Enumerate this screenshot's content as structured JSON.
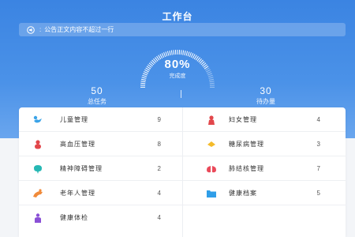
{
  "header": {
    "title": "工作台"
  },
  "notice": {
    "text": "公告正文内容不超过一行",
    "separator": ":"
  },
  "progress": {
    "percent_text": "80%",
    "value": 0.8,
    "label": "完成度"
  },
  "stats": [
    {
      "value": "50",
      "label": "总任务"
    },
    {
      "value": "30",
      "label": "待办量"
    }
  ],
  "left_items": [
    {
      "name": "儿童管理",
      "count": "9",
      "icon": "child-icon",
      "color": "#3aa3e8"
    },
    {
      "name": "高血压管理",
      "count": "8",
      "icon": "blood-pressure-icon",
      "color": "#e2474b"
    },
    {
      "name": "精神障碍管理",
      "count": "2",
      "icon": "brain-icon",
      "color": "#26b8b4"
    },
    {
      "name": "老年人管理",
      "count": "4",
      "icon": "elderly-icon",
      "color": "#f08a3a"
    },
    {
      "name": "健康体检",
      "count": "4",
      "icon": "checkup-icon",
      "color": "#8a50d6"
    }
  ],
  "right_items": [
    {
      "name": "妇女管理",
      "count": "4",
      "icon": "woman-icon",
      "color": "#e2474b"
    },
    {
      "name": "糖尿病管理",
      "count": "3",
      "icon": "diabetes-icon",
      "color": "#f4bb2a"
    },
    {
      "name": "肺结核管理",
      "count": "7",
      "icon": "lungs-icon",
      "color": "#ea4a5a"
    },
    {
      "name": "健康档案",
      "count": "5",
      "icon": "folder-icon",
      "color": "#2f9ee8"
    }
  ]
}
